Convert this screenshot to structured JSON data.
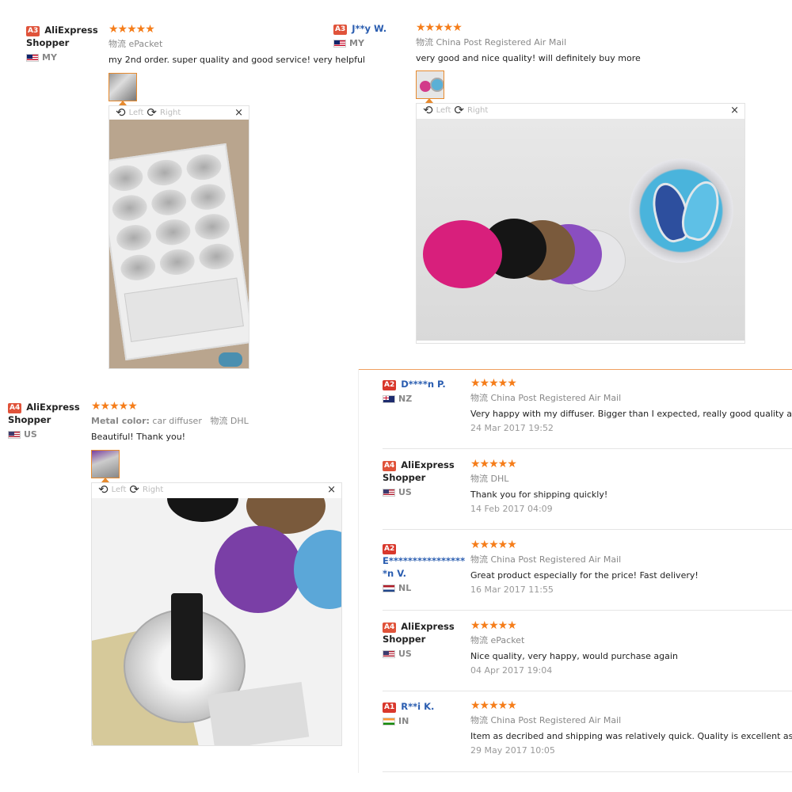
{
  "reviews_top_left": {
    "badge": "A3",
    "user": "AliExpress Shopper",
    "country": "MY",
    "stars": "★★★★★",
    "shipping_label": "物流",
    "shipping": "ePacket",
    "text": "my 2nd order. super quality and good service! very helpful",
    "rotate_left": "Left",
    "rotate_right": "Right",
    "close": "×"
  },
  "reviews_top_right": {
    "badge": "A3",
    "user": "J**y W.",
    "country": "MY",
    "stars": "★★★★★",
    "shipping_label": "物流",
    "shipping": "China Post Registered Air Mail",
    "text": "very good and nice quality! will definitely buy more",
    "rotate_left": "Left",
    "rotate_right": "Right",
    "close": "×"
  },
  "reviews_bottom_left": {
    "badge": "A4",
    "user": "AliExpress Shopper",
    "country": "US",
    "stars": "★★★★★",
    "attr_label": "Metal color:",
    "attr_value": "car diffuser",
    "shipping_label": "物流",
    "shipping": "DHL",
    "text": "Beautiful! Thank you!",
    "rotate_left": "Left",
    "rotate_right": "Right",
    "close": "×"
  },
  "review_list": [
    {
      "badge": "A2",
      "user": "D****n P.",
      "country": "NZ",
      "stars": "★★★★★",
      "shipping_label": "物流",
      "shipping": "China Post Registered Air Mail",
      "text": "Very happy with my diffuser. Bigger than I expected, really good quality and re",
      "date": "24 Mar 2017 19:52"
    },
    {
      "badge": "A4",
      "user": "AliExpress Shopper",
      "country": "US",
      "stars": "★★★★★",
      "shipping_label": "物流",
      "shipping": "DHL",
      "text": "Thank you for shipping quickly!",
      "date": "14 Feb 2017 04:09"
    },
    {
      "badge": "A2",
      "user": "E*****************n V.",
      "country": "NL",
      "stars": "★★★★★",
      "shipping_label": "物流",
      "shipping": "China Post Registered Air Mail",
      "text": "Great product especially for the price! Fast delivery!",
      "date": "16 Mar 2017 11:55"
    },
    {
      "badge": "A4",
      "user": "AliExpress Shopper",
      "country": "US",
      "stars": "★★★★★",
      "shipping_label": "物流",
      "shipping": "ePacket",
      "text": "Nice quality, very happy, would purchase again",
      "date": "04 Apr 2017 19:04"
    },
    {
      "badge": "A1",
      "user": "R**i K.",
      "country": "IN",
      "stars": "★★★★★",
      "shipping_label": "物流",
      "shipping": "China Post Registered Air Mail",
      "text": "Item as decribed and shipping was relatively quick. Quality is excellent as well.",
      "date": "29 May 2017 10:05"
    }
  ],
  "colors": {
    "star": "#f57d1a",
    "badge": "#e0533a",
    "user_blue": "#2a5db0",
    "thumb_border": "#e68a2e"
  }
}
